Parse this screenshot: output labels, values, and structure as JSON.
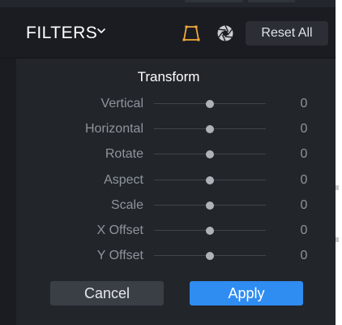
{
  "header": {
    "title": "FILTERS",
    "reset_label": "Reset All",
    "tools": [
      {
        "icon": "transform-icon",
        "active": true,
        "color": "#f2a93b"
      },
      {
        "icon": "aperture-icon",
        "active": false,
        "color": "#c9ccd0"
      }
    ]
  },
  "panel": {
    "title": "Transform",
    "rows": [
      {
        "label": "Vertical",
        "value": "0",
        "level": 0.5
      },
      {
        "label": "Horizontal",
        "value": "0",
        "level": 0.5
      },
      {
        "label": "Rotate",
        "value": "0",
        "level": 0.5
      },
      {
        "label": "Aspect",
        "value": "0",
        "level": 0.5
      },
      {
        "label": "Scale",
        "value": "0",
        "level": 0.5
      },
      {
        "label": "X Offset",
        "value": "0",
        "level": 0.5
      },
      {
        "label": "Y Offset",
        "value": "0",
        "level": 0.5
      }
    ]
  },
  "actions": {
    "cancel_label": "Cancel",
    "apply_label": "Apply"
  },
  "colors": {
    "accent": "#2f8cf1",
    "active_tool": "#f2a93b"
  }
}
